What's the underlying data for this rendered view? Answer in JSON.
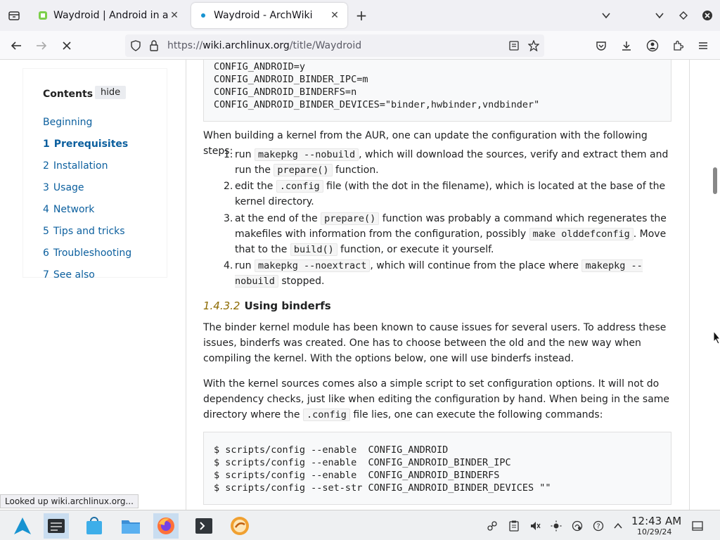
{
  "tabs": [
    {
      "title": "Waydroid | Android in a Li"
    },
    {
      "title": "Waydroid - ArchWiki"
    }
  ],
  "url": {
    "scheme": "https://",
    "host": "wiki.archlinux.org",
    "path": "/title/Waydroid"
  },
  "toc": {
    "title": "Contents",
    "hide": "hide",
    "items": [
      {
        "num": "",
        "label": "Beginning"
      },
      {
        "num": "1",
        "label": "Prerequisites"
      },
      {
        "num": "2",
        "label": "Installation"
      },
      {
        "num": "3",
        "label": "Usage"
      },
      {
        "num": "4",
        "label": "Network"
      },
      {
        "num": "5",
        "label": "Tips and tricks"
      },
      {
        "num": "6",
        "label": "Troubleshooting"
      },
      {
        "num": "7",
        "label": "See also"
      }
    ]
  },
  "code1": "CONFIG_ANDROID=y\nCONFIG_ANDROID_BINDER_IPC=m\nCONFIG_ANDROID_BINDERFS=n\nCONFIG_ANDROID_BINDER_DEVICES=\"binder,hwbinder,vndbinder\"",
  "para1": "When building a kernel from the AUR, one can update the configuration with the following steps:",
  "steps": [
    {
      "n": "1.",
      "a": "run ",
      "c1": "makepkg --nobuild",
      "b": ", which will download the sources, verify and extract them and run the ",
      "c2": "prepare()",
      "d": " function."
    },
    {
      "n": "2.",
      "a": "edit the ",
      "c1": ".config",
      "b": " file (with the dot in the filename), which is located at the base of the kernel directory."
    },
    {
      "n": "3.",
      "a": "at the end of the ",
      "c1": "prepare()",
      "b": " function was probably a command which regenerates the makefiles with information from the configuration, possibly ",
      "c2": "make olddefconfig",
      "d": ". Move that to the ",
      "c3": "build()",
      "e": " function, or execute it yourself."
    },
    {
      "n": "4.",
      "a": "run ",
      "c1": "makepkg --noextract",
      "b": ", which will continue from the place where ",
      "c2": "makepkg --nobuild",
      "d": " stopped."
    }
  ],
  "heading": {
    "num": "1.4.3.2",
    "title": "Using binderfs"
  },
  "para2": "The binder kernel module has been known to cause issues for several users. To address these issues, binderfs was created. One has to choose between the old and the new way when compiling the kernel. With the options below, one will use binderfs instead.",
  "para3": {
    "a": "With the kernel sources comes also a simple script to set configuration options. It will not do dependency checks, just like when editing the configuration by hand. When being in the same directory where the ",
    "c": ".config",
    "b": " file lies, one can execute the following commands:"
  },
  "code2": "$ scripts/config --enable  CONFIG_ANDROID\n$ scripts/config --enable  CONFIG_ANDROID_BINDER_IPC\n$ scripts/config --enable  CONFIG_ANDROID_BINDERFS\n$ scripts/config --set-str CONFIG_ANDROID_BINDER_DEVICES \"\"",
  "status": "Looked up wiki.archlinux.org...",
  "clock": {
    "time": "12:43 AM",
    "date": "10/29/24"
  },
  "colors": {
    "link": "#0b5f9e",
    "tabbar": "#f0f0f4",
    "taskbar": "#eef0f2"
  }
}
